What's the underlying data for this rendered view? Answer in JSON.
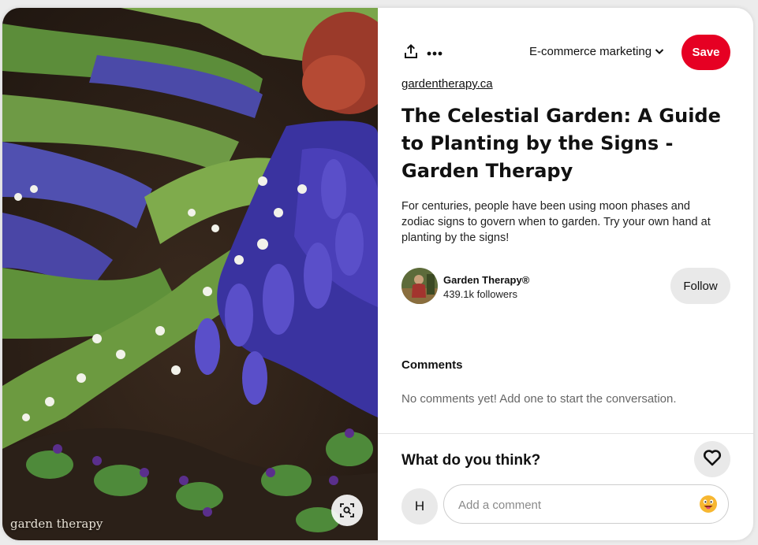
{
  "image": {
    "watermark": "garden therapy",
    "lens_icon": "visual-search-icon"
  },
  "toolbar": {
    "share_icon": "share-icon",
    "more_icon": "more-options-icon",
    "board_name": "E-commerce marketing",
    "board_chevron": "chevron-down-icon",
    "save_label": "Save"
  },
  "pin": {
    "source_link": "gardentherapy.ca",
    "title": "The Celestial Garden: A Guide to Planting by the Signs - Garden Therapy",
    "description": "For centuries, people have been using moon phases and zodiac signs to govern when to garden. Try your own hand at planting by the signs!"
  },
  "creator": {
    "name": "Garden Therapy®",
    "followers": "439.1k followers",
    "follow_label": "Follow"
  },
  "comments": {
    "heading": "Comments",
    "empty_text": "No comments yet! Add one to start the conversation."
  },
  "compose": {
    "prompt": "What do you think?",
    "user_initial": "H",
    "placeholder": "Add a comment",
    "heart_icon": "heart-icon",
    "emoji_icon": "emoji-icon"
  },
  "colors": {
    "save_red": "#e60023",
    "button_gray": "#e9e9e9"
  }
}
